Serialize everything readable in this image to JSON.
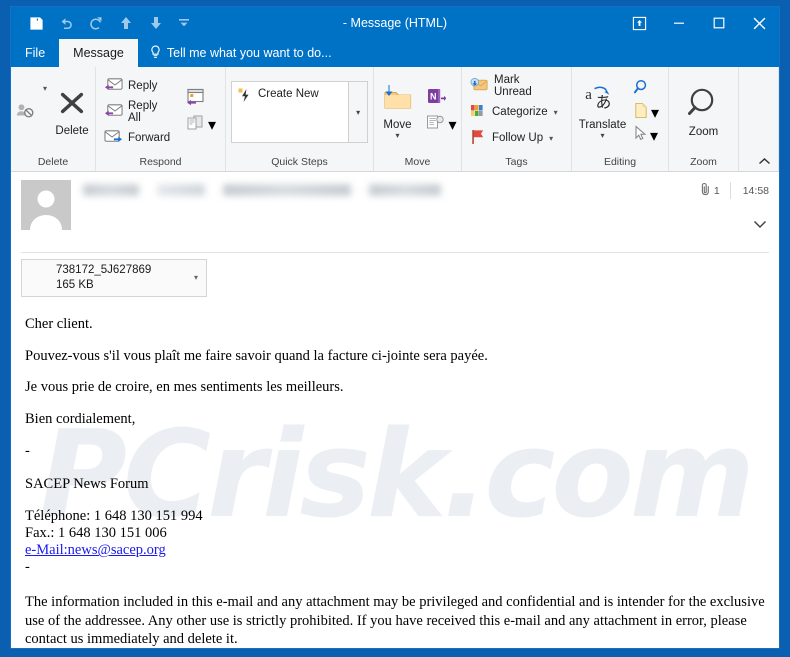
{
  "window": {
    "title": "- Message (HTML)",
    "quick_access": [
      {
        "name": "save-icon",
        "label": "Save"
      },
      {
        "name": "undo-icon",
        "label": "Undo"
      },
      {
        "name": "redo-icon",
        "label": "Redo"
      },
      {
        "name": "previous-item-icon",
        "label": "Previous Item"
      },
      {
        "name": "next-item-icon",
        "label": "Next Item"
      },
      {
        "name": "customize-qat-icon",
        "label": "Customize Quick Access Toolbar"
      }
    ],
    "controls": {
      "ribbon_display": "Ribbon Display Options",
      "minimize": "Minimize",
      "maximize": "Maximize",
      "close": "Close"
    }
  },
  "tabs": {
    "file": "File",
    "message": "Message",
    "tellme": "Tell me what you want to do..."
  },
  "ribbon": {
    "groups": [
      {
        "label": "Delete",
        "ignore_label": "Ignore",
        "delete_label": "Delete"
      },
      {
        "label": "Respond",
        "reply": "Reply",
        "reply_all": "Reply All",
        "forward": "Forward",
        "meeting": "Meeting",
        "more": "More"
      },
      {
        "label": "Quick Steps",
        "create_new": "Create New"
      },
      {
        "label": "Move",
        "move": "Move",
        "onenote": "OneNote",
        "rules": "Rules"
      },
      {
        "label": "Tags",
        "mark_unread": "Mark Unread",
        "categorize": "Categorize",
        "follow_up": "Follow Up"
      },
      {
        "label": "Editing",
        "translate": "Translate",
        "find": "Find",
        "related": "Related",
        "select": "Select"
      },
      {
        "label": "Zoom",
        "zoom": "Zoom"
      }
    ],
    "collapse": "Collapse the Ribbon"
  },
  "message_header": {
    "sender_redacted": true,
    "attachment_count": "1",
    "time": "14:58",
    "attachment": {
      "name": "738172_5J627869",
      "size": "165 KB"
    }
  },
  "body": {
    "greeting": "Cher client.",
    "paragraph_1": "Pouvez-vous s'il vous plaît me faire savoir quand la facture ci-jointe sera payée.",
    "paragraph_2": "Je vous prie de croire, en mes sentiments les meilleurs.",
    "closing": "Bien cordialement,",
    "dash_top": "-",
    "company": "SACEP News Forum",
    "phone": "Téléphone: 1 648 130 151 994",
    "fax": "Fax.: 1 648 130 151 006",
    "email_link": "e-Mail:news@sacep.org",
    "dash_bottom": "-",
    "disclaimer": "The information included in this e-mail and any attachment may be privileged and confidential and is intender for the exclusive use of the addressee. Any other use is strictly prohibited. If you have received this e-mail and any attachment in error, please contact us immediately and delete it."
  },
  "watermark": {
    "text": "PCrisk.com"
  },
  "colors": {
    "title_bar": "#0072c6",
    "window_border": "#1470c4",
    "ribbon_bg": "#f5f6f7",
    "link": "#1a1aee",
    "accent_purple": "#7b3fa0",
    "accent_orange": "#f5bd4f"
  }
}
